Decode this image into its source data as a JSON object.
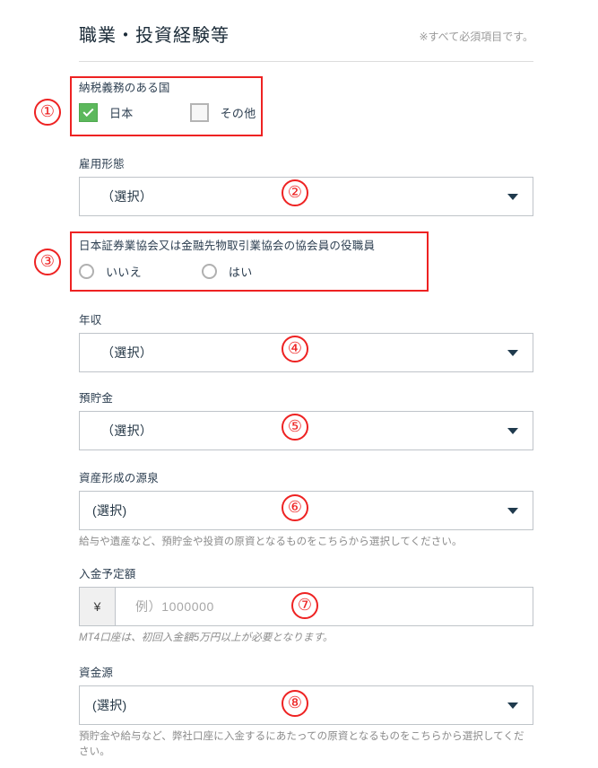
{
  "header": {
    "title": "職業・投資経験等",
    "required_note": "※すべて必須項目です。"
  },
  "fields": {
    "tax_country": {
      "label": "納税義務のある国",
      "options": [
        {
          "text": "日本",
          "checked": true
        },
        {
          "text": "その他",
          "checked": false
        }
      ]
    },
    "employment": {
      "label": "雇用形態",
      "value": "（選択）"
    },
    "association_officer": {
      "label": "日本証券業協会又は金融先物取引業協会の協会員の役職員",
      "options": [
        {
          "text": "いいえ",
          "selected": false
        },
        {
          "text": "はい",
          "selected": false
        }
      ]
    },
    "annual_income": {
      "label": "年収",
      "value": "（選択）"
    },
    "savings": {
      "label": "預貯金",
      "value": "（選択）"
    },
    "asset_source": {
      "label": "資産形成の源泉",
      "value": "(選択)",
      "helper": "給与や遺産など、預貯金や投資の原資となるものをこちらから選択してください。"
    },
    "deposit_amount": {
      "label": "入金予定額",
      "currency": "¥",
      "placeholder": "例）1000000",
      "helper": "MT4口座は、初回入金額5万円以上が必要となります。"
    },
    "fund_source": {
      "label": "資金源",
      "value": "(選択)",
      "helper": "預貯金や給与など、弊社口座に入金するにあたっての原資となるものをこちらから選択してください。"
    }
  },
  "annotations": {
    "markers": [
      "①",
      "②",
      "③",
      "④",
      "⑤",
      "⑥",
      "⑦",
      "⑧"
    ],
    "accent_color": "#ee2222"
  }
}
